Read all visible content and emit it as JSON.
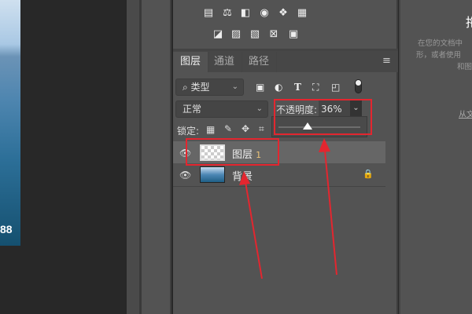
{
  "canvas": {
    "zoom_label": "88"
  },
  "adjustments": {
    "row1": [
      "levels-icon",
      "balance-icon",
      "black-white-icon",
      "photo-filter-icon",
      "channel-mixer-icon",
      "color-lookup-icon"
    ],
    "row2": [
      "invert-icon",
      "posterize-icon",
      "threshold-icon",
      "selective-color-icon",
      "gradient-map-icon"
    ]
  },
  "layers_panel": {
    "tabs": [
      {
        "label": "图层",
        "active": true
      },
      {
        "label": "通道"
      },
      {
        "label": "路径"
      }
    ],
    "filter": {
      "label": "类型"
    },
    "blend_mode": "正常",
    "opacity_label": "不透明度:",
    "opacity_value": "36%",
    "opacity_fraction": 0.36,
    "lock_label": "锁定:",
    "layers": [
      {
        "name": "图层",
        "suffix": "1",
        "selected": true
      },
      {
        "name": "背景",
        "locked": true
      }
    ]
  },
  "right_panel": {
    "title": "拖",
    "desc1": "在您的文档中",
    "desc2": "形，或者使用",
    "desc3": "和图",
    "link": "从文"
  },
  "annotation_color": "#e3262f"
}
